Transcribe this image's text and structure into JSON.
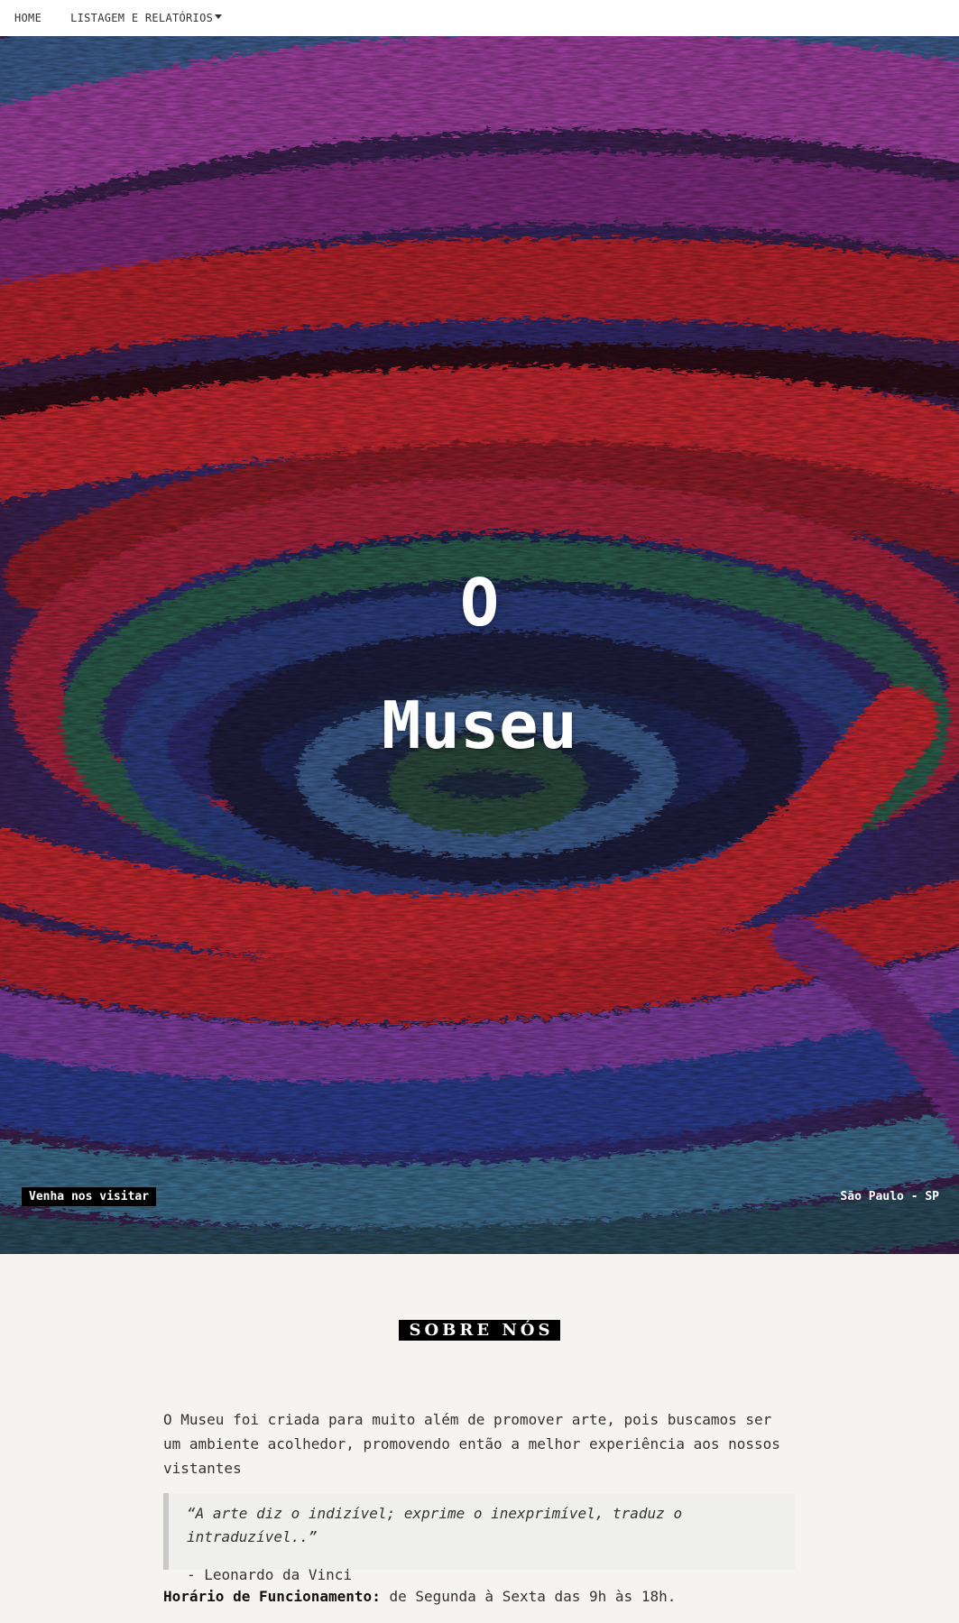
{
  "nav": {
    "home_label": "HOME",
    "reports_label": "LISTAGEM E RELATÓRIOS"
  },
  "hero": {
    "title_line1": "O",
    "title_line2": "Museu",
    "visit_badge": "Venha nos visitar",
    "location": "São Paulo - SP"
  },
  "about": {
    "heading": "SOBRE NÓS",
    "paragraph": "O Museu foi criada para muito além de promover arte, pois buscamos ser um ambiente acolhedor, promovendo então a melhor experiência aos nossos vistantes",
    "quote": "“A arte diz o indizível; exprime o inexprimível, traduz o intraduzível..”",
    "quote_author": "- Leonardo da Vinci",
    "hours_label": "Horário de Funcionamento:",
    "hours_value": " de Segunda à Sexta das 9h às 18h."
  },
  "colors": {
    "hero_red": "#b3202c",
    "hero_purple": "#9a3d9a",
    "hero_blue": "#2a3a8a",
    "hero_dark": "#141224",
    "page_bg": "#f5f4f0"
  }
}
